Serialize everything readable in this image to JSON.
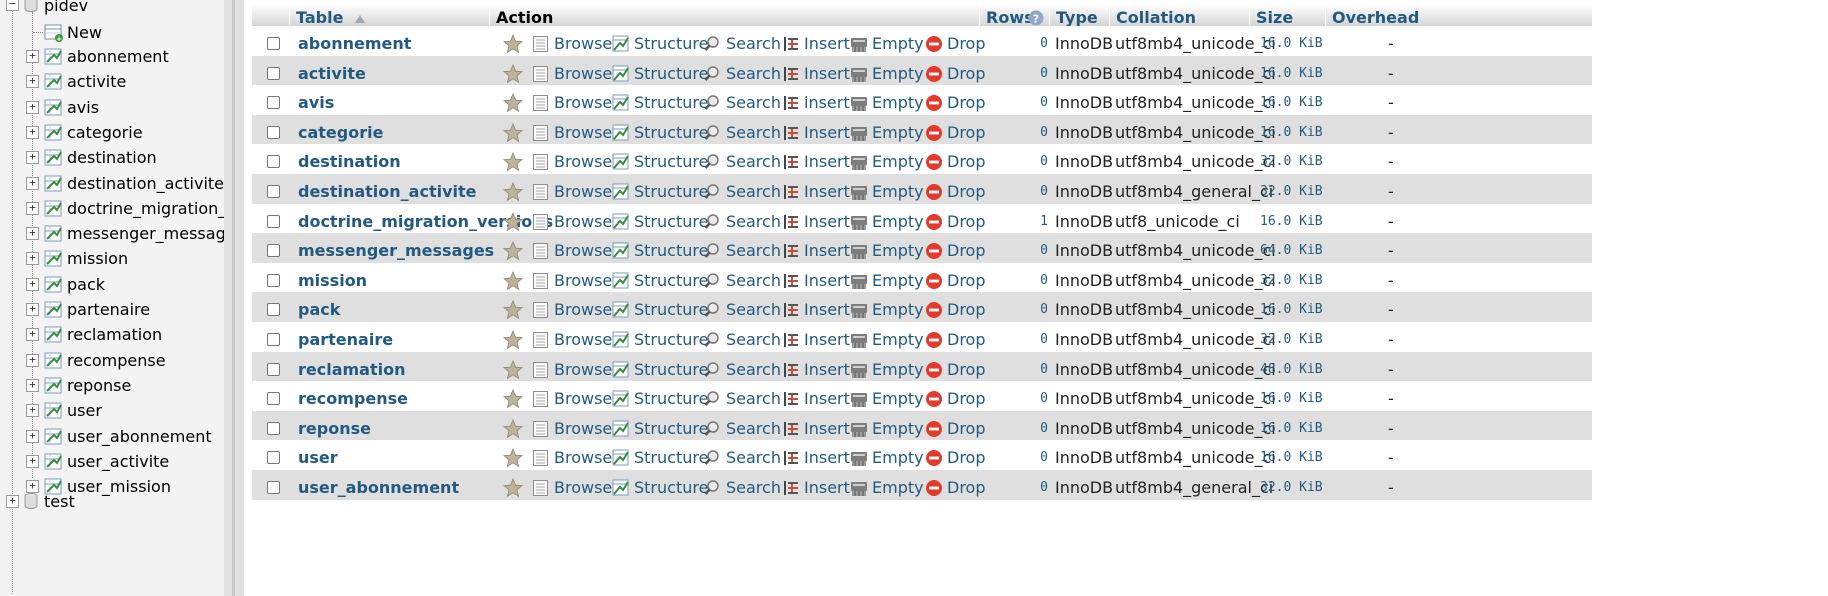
{
  "sidebar": {
    "database": "pidev",
    "new_label": "New",
    "tables": [
      "abonnement",
      "activite",
      "avis",
      "categorie",
      "destination",
      "destination_activite",
      "doctrine_migration_",
      "messenger_messag",
      "mission",
      "pack",
      "partenaire",
      "reclamation",
      "recompense",
      "reponse",
      "user",
      "user_abonnement",
      "user_activite",
      "user_mission"
    ],
    "next_database": "test"
  },
  "table_header": {
    "table": "Table",
    "action": "Action",
    "rows": "Rows",
    "type": "Type",
    "collation": "Collation",
    "size": "Size",
    "overhead": "Overhead"
  },
  "actions": {
    "browse": "Browse",
    "structure": "Structure",
    "search": "Search",
    "insert": "Insert",
    "empty": "Empty",
    "drop": "Drop"
  },
  "rows": [
    {
      "name": "abonnement",
      "rows": "0",
      "type": "InnoDB",
      "collation": "utf8mb4_unicode_ci",
      "size": "16.0 KiB",
      "overhead": "-",
      "insert": "Insert"
    },
    {
      "name": "activite",
      "rows": "0",
      "type": "InnoDB",
      "collation": "utf8mb4_unicode_ci",
      "size": "16.0 KiB",
      "overhead": "-",
      "insert": "Insert"
    },
    {
      "name": "avis",
      "rows": "0",
      "type": "InnoDB",
      "collation": "utf8mb4_unicode_ci",
      "size": "16.0 KiB",
      "overhead": "-",
      "insert": "insert"
    },
    {
      "name": "categorie",
      "rows": "0",
      "type": "InnoDB",
      "collation": "utf8mb4_unicode_ci",
      "size": "16.0 KiB",
      "overhead": "-",
      "insert": "Insert"
    },
    {
      "name": "destination",
      "rows": "0",
      "type": "InnoDB",
      "collation": "utf8mb4_unicode_ci",
      "size": "32.0 KiB",
      "overhead": "-",
      "insert": "Insert"
    },
    {
      "name": "destination_activite",
      "rows": "0",
      "type": "InnoDB",
      "collation": "utf8mb4_general_ci",
      "size": "32.0 KiB",
      "overhead": "-",
      "insert": "Insert"
    },
    {
      "name": "doctrine_migration_versions",
      "rows": "1",
      "type": "InnoDB",
      "collation": "utf8_unicode_ci",
      "size": "16.0 KiB",
      "overhead": "-",
      "insert": "Insert"
    },
    {
      "name": "messenger_messages",
      "rows": "0",
      "type": "InnoDB",
      "collation": "utf8mb4_unicode_ci",
      "size": "64.0 KiB",
      "overhead": "-",
      "insert": "Insert"
    },
    {
      "name": "mission",
      "rows": "0",
      "type": "InnoDB",
      "collation": "utf8mb4_unicode_ci",
      "size": "32.0 KiB",
      "overhead": "-",
      "insert": "Insert"
    },
    {
      "name": "pack",
      "rows": "0",
      "type": "InnoDB",
      "collation": "utf8mb4_unicode_ci",
      "size": "16.0 KiB",
      "overhead": "-",
      "insert": "Insert"
    },
    {
      "name": "partenaire",
      "rows": "0",
      "type": "InnoDB",
      "collation": "utf8mb4_unicode_ci",
      "size": "32.0 KiB",
      "overhead": "-",
      "insert": "Insert"
    },
    {
      "name": "reclamation",
      "rows": "0",
      "type": "InnoDB",
      "collation": "utf8mb4_unicode_ci",
      "size": "48.0 KiB",
      "overhead": "-",
      "insert": "Insert"
    },
    {
      "name": "recompense",
      "rows": "0",
      "type": "InnoDB",
      "collation": "utf8mb4_unicode_ci",
      "size": "16.0 KiB",
      "overhead": "-",
      "insert": "Insert"
    },
    {
      "name": "reponse",
      "rows": "0",
      "type": "InnoDB",
      "collation": "utf8mb4_unicode_ci",
      "size": "16.0 KiB",
      "overhead": "-",
      "insert": "Insert"
    },
    {
      "name": "user",
      "rows": "0",
      "type": "InnoDB",
      "collation": "utf8mb4_unicode_ci",
      "size": "16.0 KiB",
      "overhead": "-",
      "insert": "Insert"
    },
    {
      "name": "user_abonnement",
      "rows": "0",
      "type": "InnoDB",
      "collation": "utf8mb4_general_ci",
      "size": "32.0 KiB",
      "overhead": "-",
      "insert": "Insert"
    }
  ],
  "colors": {
    "link": "#235a81",
    "row_alt": "#dfdfdf",
    "sidebar_bg": "#f3f3f3",
    "drop": "#e23b2e"
  }
}
